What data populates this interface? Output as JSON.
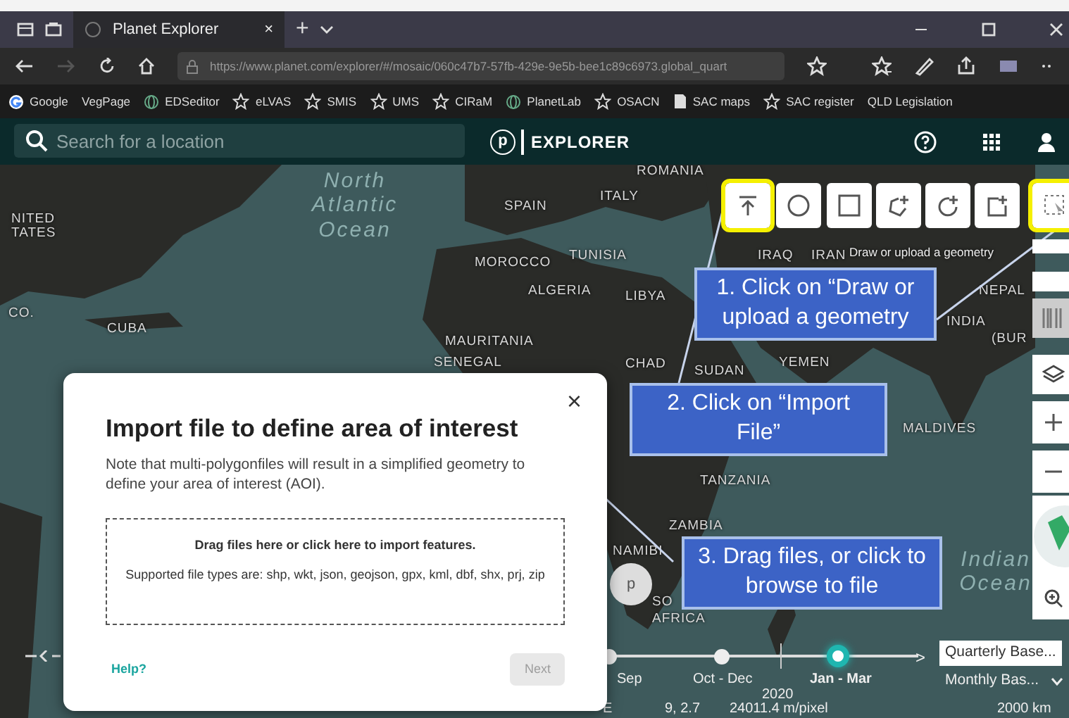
{
  "browser": {
    "tab_title": "Planet Explorer",
    "tab_close": "×",
    "new_tab": "+",
    "url": "https://www.planet.com/explorer/#/mosaic/060c47b7-57fb-429e-9e5b-bee1c89c6973.global_quart",
    "bookmarks": [
      {
        "label": "Google",
        "kind": "google"
      },
      {
        "label": "VegPage",
        "kind": "none"
      },
      {
        "label": "EDSeditor",
        "kind": "globe"
      },
      {
        "label": "eLVAS",
        "kind": "star"
      },
      {
        "label": "SMIS",
        "kind": "star"
      },
      {
        "label": "UMS",
        "kind": "star"
      },
      {
        "label": "CIRaM",
        "kind": "star"
      },
      {
        "label": "PlanetLab",
        "kind": "globe"
      },
      {
        "label": "OSACN",
        "kind": "star"
      },
      {
        "label": "SAC maps",
        "kind": "page"
      },
      {
        "label": "SAC register",
        "kind": "star"
      },
      {
        "label": "QLD Legislation",
        "kind": "none"
      }
    ]
  },
  "app_header": {
    "search_placeholder": "Search for a location",
    "logo_mark": "p",
    "logo_text": "EXPLORER"
  },
  "tools": [
    {
      "kind": "upload",
      "highlighted": true
    },
    {
      "kind": "circle",
      "highlighted": false
    },
    {
      "kind": "square",
      "highlighted": false
    },
    {
      "kind": "polygon-plus",
      "highlighted": false
    },
    {
      "kind": "circle-plus",
      "highlighted": false
    },
    {
      "kind": "square-plus",
      "highlighted": false
    },
    {
      "kind": "select",
      "highlighted": true
    }
  ],
  "tooltip": "Draw or upload a geometry",
  "map_labels": [
    {
      "text": "ROMANIA",
      "kind": "country"
    },
    {
      "text": "ITALY",
      "kind": "country"
    },
    {
      "text": "SPAIN",
      "kind": "country"
    },
    {
      "text": "NITED",
      "kind": "country"
    },
    {
      "text": "TATES",
      "kind": "country"
    },
    {
      "text": "North Atlantic Ocean",
      "kind": "ocean"
    },
    {
      "text": "MOROCCO",
      "kind": "country"
    },
    {
      "text": "TUNISIA",
      "kind": "country"
    },
    {
      "text": "ALGERIA",
      "kind": "country"
    },
    {
      "text": "LIBYA",
      "kind": "country"
    },
    {
      "text": "IRAQ",
      "kind": "country"
    },
    {
      "text": "IRAN",
      "kind": "country"
    },
    {
      "text": "NEPAL",
      "kind": "country"
    },
    {
      "text": "INDIA",
      "kind": "country"
    },
    {
      "text": "CO.",
      "kind": "country"
    },
    {
      "text": "CUBA",
      "kind": "country"
    },
    {
      "text": "(BUR",
      "kind": "country"
    },
    {
      "text": "MAURITANIA",
      "kind": "country"
    },
    {
      "text": "SENEGAL",
      "kind": "country"
    },
    {
      "text": "CHAD",
      "kind": "country"
    },
    {
      "text": "SUDAN",
      "kind": "country"
    },
    {
      "text": "YEMEN",
      "kind": "country"
    },
    {
      "text": "MALDIVES",
      "kind": "country"
    },
    {
      "text": "TANZANIA",
      "kind": "country"
    },
    {
      "text": "ZAMBIA",
      "kind": "country"
    },
    {
      "text": "NAMIBI",
      "kind": "country"
    },
    {
      "text": "SO",
      "kind": "country"
    },
    {
      "text": "AFRICA",
      "kind": "country"
    },
    {
      "text": "Indian Ocean",
      "kind": "ocean"
    }
  ],
  "callouts": [
    "1. Click on “Draw or upload a geometry",
    "2. Click on “Import File”",
    "3. Drag files, or click to browse to file"
  ],
  "dialog": {
    "close": "×",
    "title": "Import file to define area of interest",
    "note": "Note that multi-polygonfiles will result in a simplified geometry to define your area of interest (AOI).",
    "drop_title": "Drag files here or click here to import features.",
    "drop_hint": "Supported file types are: shp, wkt, json, geojson, gpx, kml, dbf, shx, prj, zip",
    "help": "Help?",
    "next": {
      "label": "Next",
      "disabled": true
    }
  },
  "side_button": "p",
  "timeline": {
    "periods": [
      {
        "label": "Sep",
        "selected": false
      },
      {
        "label": "Oct - Dec",
        "selected": false
      },
      {
        "label": "Jan - Mar",
        "selected": true
      }
    ],
    "year": "2020",
    "next": ">",
    "layers": [
      {
        "label": "Quarterly Base...",
        "selected": true
      },
      {
        "label": "Monthly Bas...",
        "selected": false
      }
    ]
  },
  "status": [
    "E",
    "9, 2.7",
    "24011.4 m/pixel",
    "2000 km"
  ]
}
